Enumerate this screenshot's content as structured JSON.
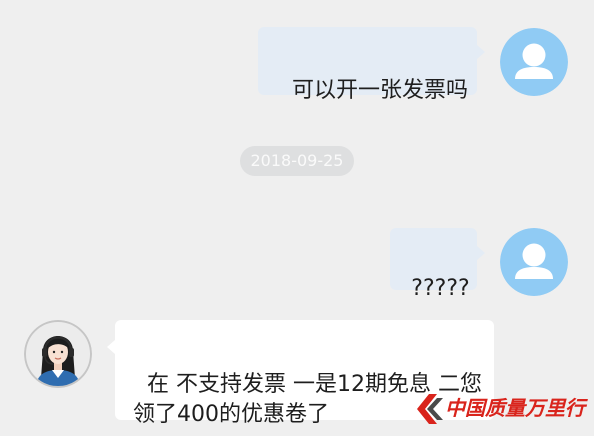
{
  "colors": {
    "background": "#efefef",
    "user_bubble": "#e4ecf5",
    "agent_bubble": "#ffffff",
    "avatar": "#90cbf4",
    "timestamp_pill": "#dedfe0",
    "timestamp_text": "#fafafa",
    "message_text": "#1e1e1e",
    "watermark": "#d9241c"
  },
  "chat": {
    "message_1": {
      "text": "可以开一张发票吗",
      "avatar_icon": "user-avatar-icon"
    },
    "timestamp": "2018-09-25",
    "message_2": {
      "text": "?????",
      "avatar_icon": "user-avatar-icon"
    },
    "message_3": {
      "text": "在 不支持发票 一是12期免息 二您\n领了400的优惠卷了",
      "avatar_icon": "agent-avatar-icon"
    }
  },
  "watermark": {
    "text": "中国质量万里行",
    "logo_icon": "chevron-logo-icon"
  }
}
